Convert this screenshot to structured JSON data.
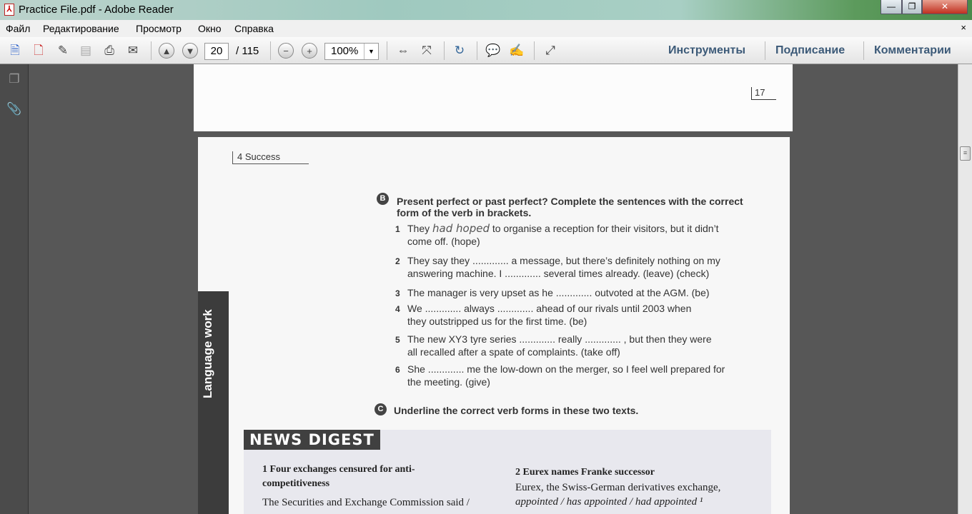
{
  "window": {
    "title": "Practice File.pdf - Adobe Reader",
    "minimize": "—",
    "maximize": "❐",
    "close": "✕",
    "close_doc": "×"
  },
  "menu": [
    "Файл",
    "Редактирование",
    "Просмотр",
    "Окно",
    "Справка"
  ],
  "toolbar": {
    "page_current": "20",
    "page_total": "/ 115",
    "zoom": "100%",
    "tools": "Инструменты",
    "sign": "Подписание",
    "comments": "Комментарии"
  },
  "page_top": {
    "page_number": "17"
  },
  "page": {
    "unit": "4 Success",
    "side_tab": "Language work",
    "section_b": {
      "badge": "B",
      "heading": "Present perfect or past perfect? Complete the sentences with the correct form of the verb in brackets.",
      "items": [
        {
          "n": "1",
          "pre": "They ",
          "answer": "had hoped",
          "post": " to organise a reception for their visitors, but it didn’t",
          "cont": "come off. (hope)"
        },
        {
          "n": "2",
          "text": "They say they ............. a message, but there’s definitely nothing on my",
          "cont": "answering machine. I ............. several times already. (leave) (check)"
        },
        {
          "n": "3",
          "text": "The manager is very upset as he ............. outvoted at the AGM. (be)"
        },
        {
          "n": "4",
          "text": "We ............. always ............. ahead of our rivals until 2003 when",
          "cont": "they outstripped us for the first time. (be)"
        },
        {
          "n": "5",
          "text": "The new XY3 tyre series ............. really ............. , but then they were",
          "cont": "all recalled after a spate of complaints. (take off)"
        },
        {
          "n": "6",
          "text": "She ............. me the low-down on the merger, so I feel well prepared for",
          "cont": "the meeting. (give)"
        }
      ]
    },
    "section_c": {
      "badge": "C",
      "heading": "Underline the correct verb forms in these two texts."
    },
    "news": {
      "banner": "NEWS DIGEST",
      "story1": {
        "title": "1   Four exchanges censured for anti-competitiveness",
        "body": "The Securities and Exchange Commission said /"
      },
      "story2": {
        "title": "2   Eurex names Franke successor",
        "body1": "Eurex, the Swiss-German derivatives exchange,",
        "body2": "appointed / has appointed / had appointed ¹"
      }
    }
  }
}
